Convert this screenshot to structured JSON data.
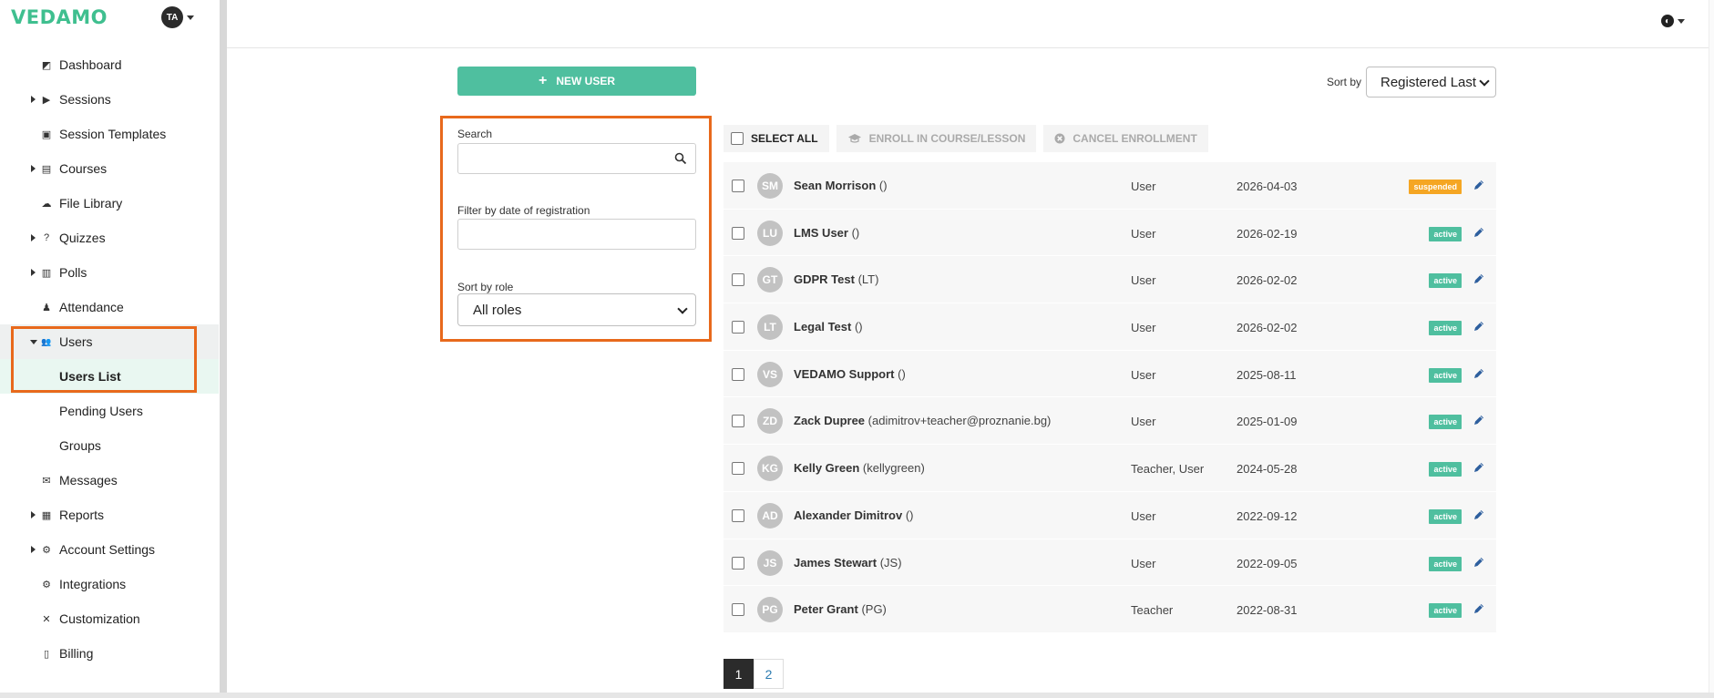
{
  "brand": {
    "logo_text": "VEDAMO",
    "avatar_initials": "TA",
    "brand_color": "#3fbf8f"
  },
  "sidebar": {
    "items": [
      {
        "label": "Dashboard",
        "icon": "dashboard-icon",
        "arrow": "none"
      },
      {
        "label": "Sessions",
        "icon": "play-circle-icon",
        "arrow": "right"
      },
      {
        "label": "Session Templates",
        "icon": "template-icon",
        "arrow": "none"
      },
      {
        "label": "Courses",
        "icon": "book-icon",
        "arrow": "right"
      },
      {
        "label": "File Library",
        "icon": "cloud-upload-icon",
        "arrow": "none"
      },
      {
        "label": "Quizzes",
        "icon": "question-circle-icon",
        "arrow": "right"
      },
      {
        "label": "Polls",
        "icon": "bar-chart-icon",
        "arrow": "right"
      },
      {
        "label": "Attendance",
        "icon": "user-check-icon",
        "arrow": "none"
      },
      {
        "label": "Users",
        "icon": "users-icon",
        "arrow": "down"
      },
      {
        "label": "Users List",
        "icon": "",
        "arrow": "none"
      },
      {
        "label": "Pending Users",
        "icon": "",
        "arrow": "none"
      },
      {
        "label": "Groups",
        "icon": "",
        "arrow": "none"
      },
      {
        "label": "Messages",
        "icon": "envelope-icon",
        "arrow": "none"
      },
      {
        "label": "Reports",
        "icon": "report-icon",
        "arrow": "right"
      },
      {
        "label": "Account Settings",
        "icon": "gear-icon",
        "arrow": "right"
      },
      {
        "label": "Integrations",
        "icon": "cogs-icon",
        "arrow": "none"
      },
      {
        "label": "Customization",
        "icon": "tools-icon",
        "arrow": "none"
      },
      {
        "label": "Billing",
        "icon": "receipt-icon",
        "arrow": "none"
      }
    ]
  },
  "toolbar_top": {
    "new_user_label": "NEW USER",
    "sort_label": "Sort by",
    "sort_value": "Registered Last"
  },
  "filters": {
    "search_label": "Search",
    "search_value": "",
    "date_label": "Filter by date of registration",
    "date_value": "",
    "role_label": "Sort by role",
    "role_value": "All roles"
  },
  "list_actions": {
    "select_all": "SELECT ALL",
    "enroll": "ENROLL IN COURSE/LESSON",
    "cancel": "CANCEL ENROLLMENT"
  },
  "users": [
    {
      "initials": "SM",
      "name": "Sean Morrison",
      "login": "()",
      "role": "User",
      "date": "2026-04-03",
      "status": "suspended"
    },
    {
      "initials": "LU",
      "name": "LMS User",
      "login": "()",
      "role": "User",
      "date": "2026-02-19",
      "status": "active"
    },
    {
      "initials": "GT",
      "name": "GDPR Test",
      "login": "(LT)",
      "role": "User",
      "date": "2026-02-02",
      "status": "active"
    },
    {
      "initials": "LT",
      "name": "Legal Test",
      "login": "()",
      "role": "User",
      "date": "2026-02-02",
      "status": "active"
    },
    {
      "initials": "VS",
      "name": "VEDAMO Support",
      "login": "()",
      "role": "User",
      "date": "2025-08-11",
      "status": "active"
    },
    {
      "initials": "ZD",
      "name": "Zack Dupree",
      "login": "(adimitrov+teacher@proznanie.bg)",
      "role": "User",
      "date": "2025-01-09",
      "status": "active"
    },
    {
      "initials": "KG",
      "name": "Kelly Green",
      "login": "(kellygreen)",
      "role": "Teacher, User",
      "date": "2024-05-28",
      "status": "active"
    },
    {
      "initials": "AD",
      "name": "Alexander Dimitrov",
      "login": "()",
      "role": "User",
      "date": "2022-09-12",
      "status": "active"
    },
    {
      "initials": "JS",
      "name": "James Stewart",
      "login": "(JS)",
      "role": "User",
      "date": "2022-09-05",
      "status": "active"
    },
    {
      "initials": "PG",
      "name": "Peter Grant",
      "login": "(PG)",
      "role": "Teacher",
      "date": "2022-08-31",
      "status": "active"
    }
  ],
  "pagination": {
    "pages": [
      "1",
      "2"
    ],
    "current": "1"
  },
  "colors": {
    "accent": "#4fbf9f",
    "suspended": "#f5a623",
    "highlight": "#e8691c"
  }
}
